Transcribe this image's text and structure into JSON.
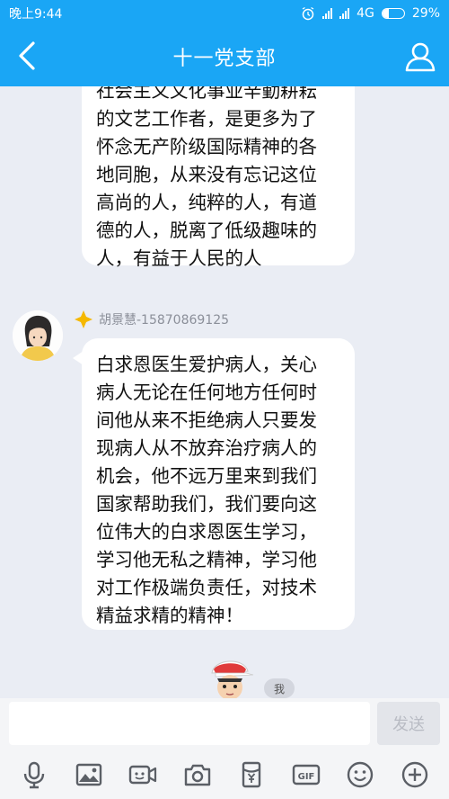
{
  "status_bar": {
    "time": "晚上9:44",
    "network": "4G",
    "battery": "29%",
    "battery_level": 0.29
  },
  "header": {
    "title": "十一党支部",
    "back_icon": "chevron-left-icon",
    "profile_icon": "group-profile-icon"
  },
  "messages": [
    {
      "lines": [
        "社会主义文化事业辛勤耕耘",
        "的文艺工作者，是更多为了",
        "怀念无产阶级国际精神的各",
        "地同胞，从来没有忘记这位",
        "高尚的人，纯粹的人，有道",
        "德的人，脱离了低级趣味的",
        "人，有益于人民的人"
      ]
    },
    {
      "sender": "胡景慧-15870869125",
      "badge_icon": "diamond-star-icon",
      "lines": [
        "白求恩医生爱护病人，关心",
        "病人无论在任何地方任何时",
        "间他从来不拒绝病人只要发",
        "现病人从不放弃治疗病人的",
        "机会，他不远万里来到我们",
        "国家帮助我们，我们要向这",
        "位伟大的白求恩医生学习，",
        "学习他无私之精神，学习他",
        "对工作极端负责任，对技术",
        "精益求精的精神！"
      ]
    }
  ],
  "me_label": "我",
  "input": {
    "value": "",
    "placeholder": "",
    "send_label": "发送"
  },
  "toolbar": [
    "mic-icon",
    "image-icon",
    "video-icon",
    "camera-icon",
    "red-packet-icon",
    "gif-icon",
    "emoji-icon",
    "plus-icon"
  ],
  "colors": {
    "header": "#1aa6f5",
    "background": "#eaedf4",
    "bubble": "#ffffff"
  }
}
